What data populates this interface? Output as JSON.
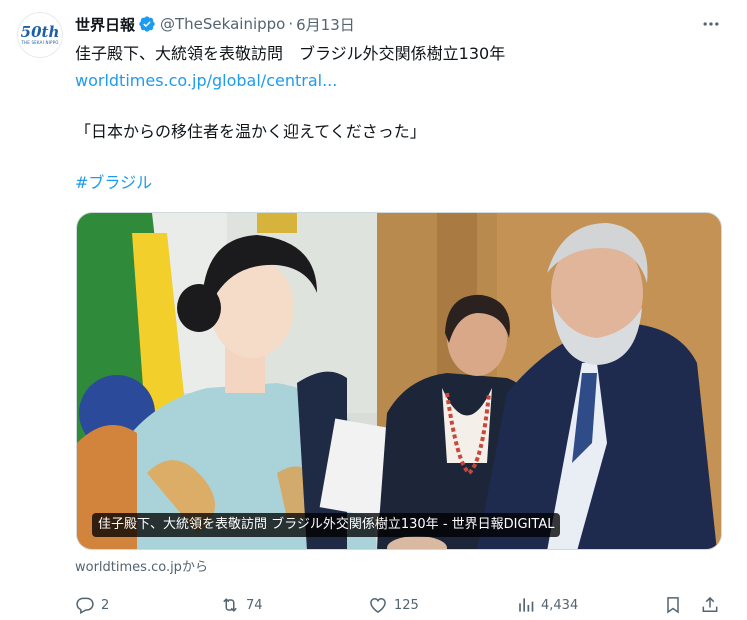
{
  "account": {
    "display_name": "世界日報",
    "handle": "@TheSekainippo",
    "separator": "·",
    "date": "6月13日",
    "avatar_text": "50th",
    "avatar_subtext": "THE SEKAI NIPPO"
  },
  "tweet": {
    "line1": "佳子殿下、大統領を表敬訪問　ブラジル外交関係樹立130年",
    "link": "worldtimes.co.jp/global/central...",
    "quote": "「日本からの移住者を温かく迎えてくださった」",
    "hashtag": "#ブラジル"
  },
  "card": {
    "caption": "佳子殿下、大統領を表敬訪問 ブラジル外交関係樹立130年 - 世界日報DIGITAL",
    "source": "worldtimes.co.jpから"
  },
  "actions": {
    "replies": "2",
    "reposts": "74",
    "likes": "125",
    "views": "4,434"
  },
  "colors": {
    "accent": "#1d9bf0",
    "muted": "#536471",
    "text": "#0f1419"
  },
  "icons": [
    "verified-badge-icon",
    "more-icon",
    "reply-icon",
    "repost-icon",
    "like-icon",
    "views-icon",
    "bookmark-icon",
    "share-icon"
  ]
}
